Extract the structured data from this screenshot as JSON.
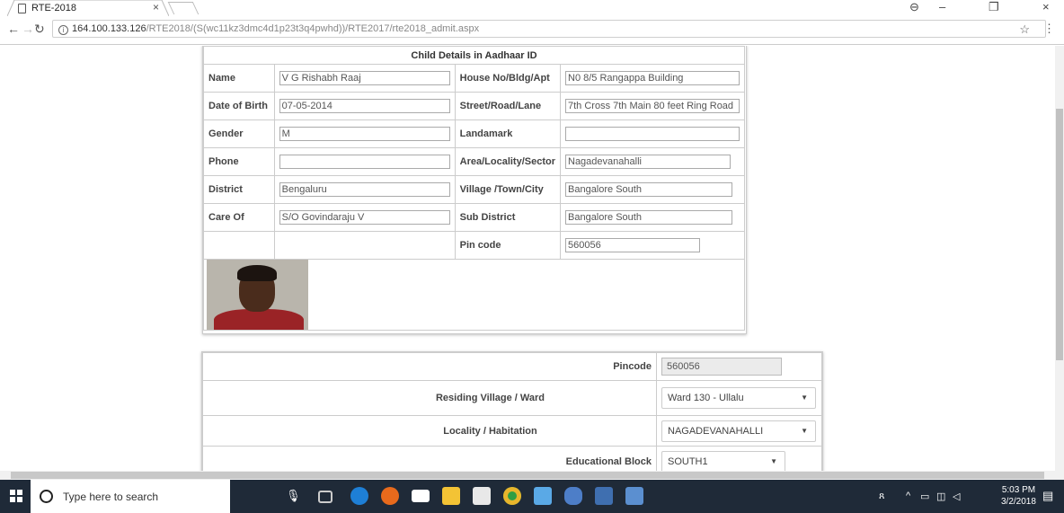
{
  "browser": {
    "tab_title": "RTE-2018",
    "tab_close": "×",
    "url_host": "164.100.133.126",
    "url_path": "/RTE2018/(S(wc11kz3dmc4d1p23t3q4pwhd))/RTE2017/rte2018_admit.aspx",
    "window_controls": {
      "account": "⊖",
      "minimize": "–",
      "restore": "❐",
      "close": "×"
    }
  },
  "child_details": {
    "header": "Child Details in Aadhaar ID",
    "rows": [
      {
        "label": "Name",
        "value": "V G Rishabh Raaj",
        "label2": "House No/Bldg/Apt",
        "value2": "N0 8/5 Rangappa Building"
      },
      {
        "label": "Date of Birth",
        "value": "07-05-2014",
        "label2": "Street/Road/Lane",
        "value2": "7th Cross 7th Main 80 feet Ring Road"
      },
      {
        "label": "Gender",
        "value": "M",
        "label2": "Landamark",
        "value2": ""
      },
      {
        "label": "Phone",
        "value": "",
        "label2": "Area/Locality/Sector",
        "value2": "Nagadevanahalli"
      },
      {
        "label": "District",
        "value": "Bengaluru",
        "label2": "Village /Town/City",
        "value2": "Bangalore South"
      },
      {
        "label": "Care Of",
        "value": "S/O Govindaraju V",
        "label2": "Sub District",
        "value2": "Bangalore South"
      }
    ],
    "pin_label": "Pin code",
    "pin_value": "560056"
  },
  "location": {
    "pincode_label": "Pincode",
    "pincode_value": "560056",
    "ward_label": "Residing Village / Ward",
    "ward_value": "Ward 130 - Ullalu",
    "locality_label": "Locality / Habitation",
    "locality_value": "NAGADEVANAHALLI",
    "block_label": "Educational Block",
    "block_value": "SOUTH1"
  },
  "taskbar": {
    "search_placeholder": "Type here to search",
    "time": "5:03 PM",
    "date": "3/2/2018"
  }
}
